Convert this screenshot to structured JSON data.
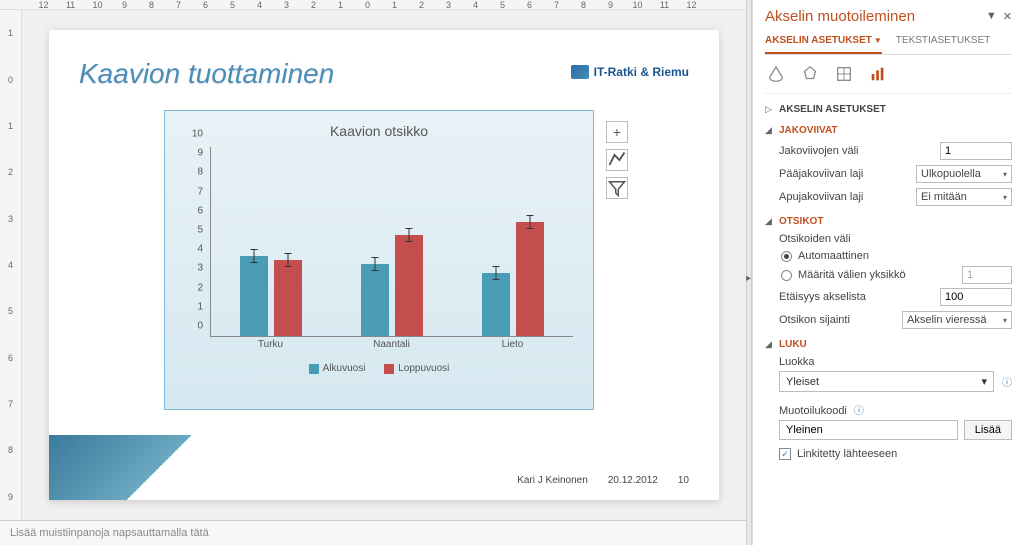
{
  "ruler_h": [
    "12",
    "11",
    "10",
    "9",
    "8",
    "7",
    "6",
    "5",
    "4",
    "3",
    "2",
    "1",
    "0",
    "1",
    "2",
    "3",
    "4",
    "5",
    "6",
    "7",
    "8",
    "9",
    "10",
    "11",
    "12"
  ],
  "ruler_v": [
    "1",
    "0",
    "1",
    "2",
    "3",
    "4",
    "5",
    "6",
    "7",
    "8",
    "9"
  ],
  "slide": {
    "title": "Kaavion tuottaminen",
    "logo_text": "IT-Ratki & Riemu",
    "chart_title": "Kaavion otsikko",
    "legend_a": "Alkuvuosi",
    "legend_b": "Loppuvuosi",
    "footer_author": "Kari J Keinonen",
    "footer_date": "20.12.2012",
    "footer_page": "10"
  },
  "chart_data": {
    "type": "bar",
    "title": "Kaavion otsikko",
    "categories": [
      "Turku",
      "Naantali",
      "Lieto"
    ],
    "series": [
      {
        "name": "Alkuvuosi",
        "values": [
          4.2,
          3.8,
          3.3
        ],
        "color": "#4a9bb5"
      },
      {
        "name": "Loppuvuosi",
        "values": [
          4.0,
          5.3,
          6.0
        ],
        "color": "#c44e4e"
      }
    ],
    "error_bars": true,
    "ylim": [
      0,
      10
    ],
    "yticks": [
      0,
      1,
      2,
      3,
      4,
      5,
      6,
      7,
      8,
      9,
      10
    ],
    "xlabel": "",
    "ylabel": ""
  },
  "notes_placeholder": "Lisää muistiinpanoja napsauttamalla tätä",
  "panel": {
    "title": "Akselin muotoileminen",
    "tab1": "AKSELIN ASETUKSET",
    "tab2": "TEKSTIASETUKSET",
    "sec_axis": "AKSELIN ASETUKSET",
    "sec_ticks": "JAKOVIIVAT",
    "ticks_interval_label": "Jakoviivojen väli",
    "ticks_interval_value": "1",
    "major_tick_label": "Pääjakoviivan laji",
    "major_tick_value": "Ulkopuolella",
    "minor_tick_label": "Apujakoviivan laji",
    "minor_tick_value": "Ei mitään",
    "sec_labels": "OTSIKOT",
    "labels_interval_label": "Otsikoiden väli",
    "radio_auto": "Automaattinen",
    "radio_specify": "Määritä välien yksikkö",
    "radio_specify_value": "1",
    "distance_label": "Etäisyys akselista",
    "distance_value": "100",
    "label_pos_label": "Otsikon sijainti",
    "label_pos_value": "Akselin vieressä",
    "sec_number": "LUKU",
    "category_label": "Luokka",
    "category_value": "Yleiset",
    "format_code_label": "Muotoilukoodi",
    "format_code_value": "Yleinen",
    "add_button": "Lisää",
    "linked_label": "Linkitetty lähteeseen"
  }
}
